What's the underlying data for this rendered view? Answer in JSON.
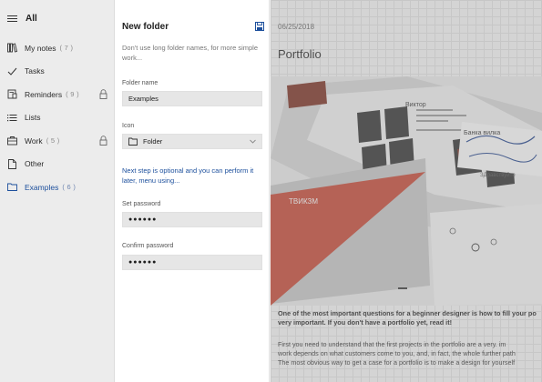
{
  "sidebar": {
    "header": {
      "label": "All"
    },
    "items": [
      {
        "label": "My notes",
        "count": "( 7 )",
        "icon": "book-icon",
        "locked": false
      },
      {
        "label": "Tasks",
        "count": "",
        "icon": "checkmark-icon",
        "locked": false
      },
      {
        "label": "Reminders",
        "count": "( 9 )",
        "icon": "reminder-icon",
        "locked": true
      },
      {
        "label": "Lists",
        "count": "",
        "icon": "list-icon",
        "locked": false
      },
      {
        "label": "Work",
        "count": "( 5 )",
        "icon": "briefcase-icon",
        "locked": true
      },
      {
        "label": "Other",
        "count": "",
        "icon": "document-icon",
        "locked": false
      },
      {
        "label": "Examples",
        "count": "( 6 )",
        "icon": "folder-icon",
        "locked": false,
        "active": true
      }
    ]
  },
  "panel": {
    "title": "New folder",
    "hint": "Don't use long folder names, for more simple work...",
    "folder_name": {
      "label": "Folder name",
      "value": "Examples"
    },
    "icon_select": {
      "label": "Icon",
      "value": "Folder"
    },
    "optional_note": "Next step is optional and you can perform it later, menu using...",
    "set_password": {
      "label": "Set password",
      "value": "●●●●●●"
    },
    "confirm_password": {
      "label": "Confirm password",
      "value": "●●●●●●"
    }
  },
  "content": {
    "date": "06/25/2018",
    "title": "Portfolio",
    "body_bold": [
      "One of the most important questions for a beginner designer is how to fill your po",
      "very important. If you don't have a portfolio yet, read it!"
    ],
    "body": [
      "First you need to understand that the first projects in the portfolio are a very. im",
      "work depends on what customers come to you, and, in fact, the whole further path",
      "The most obvious way to get a case for a portfolio is to make a design for yourself"
    ],
    "image_texts": {
      "book_title": "Виктор",
      "red_card": "ТВИКЗМ",
      "handwriting": "Банка вилка",
      "tab": "ЗДравствуйте"
    }
  },
  "colors": {
    "accent": "#1c4f9c",
    "sidebar_bg": "#ececec",
    "field_bg": "#e6e6e6",
    "overlay": "#969696"
  }
}
